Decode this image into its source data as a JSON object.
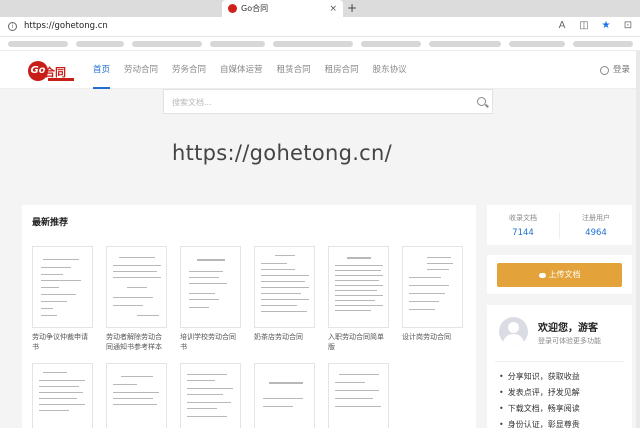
{
  "browser": {
    "tab_title": "Go合同",
    "tab_close": "×",
    "new_tab": "+",
    "url": "https://gohetong.cn",
    "icons": [
      "read-aloud-icon",
      "split-screen-icon",
      "favorite-star-icon",
      "collections-icon"
    ]
  },
  "site": {
    "nav": [
      "首页",
      "劳动合同",
      "劳务合同",
      "自媒体运营",
      "租赁合同",
      "租房合同",
      "股东协议"
    ],
    "login": "登录"
  },
  "search": {
    "placeholder": "搜索文档..."
  },
  "watermark": "https://gohetong.cn/",
  "recommend": {
    "title": "最新推荐",
    "docs": [
      {
        "title": "劳动争议仲裁申请书"
      },
      {
        "title": "劳动者解除劳动合同通知书参考样本"
      },
      {
        "title": "培训学校劳动合同书"
      },
      {
        "title": "奶茶店劳动合同"
      },
      {
        "title": "入职劳动合同简单版"
      },
      {
        "title": "设计岗劳动合同"
      }
    ]
  },
  "stats": {
    "docs_label": "收录文档",
    "docs_value": "7144",
    "users_label": "注册用户",
    "users_value": "4964"
  },
  "upload": {
    "label": "上传文档"
  },
  "welcome": {
    "title": "欢迎您，游客",
    "subtitle": "登录可体验更多功能",
    "benefits": [
      "分享知识，获取收益",
      "发表点评，抒发见解",
      "下载文档，畅享阅读",
      "身份认证，彰显尊贵"
    ]
  },
  "colors": {
    "accent": "#1f6fd1",
    "brand": "#c81e18",
    "upload": "#e3a33a"
  }
}
